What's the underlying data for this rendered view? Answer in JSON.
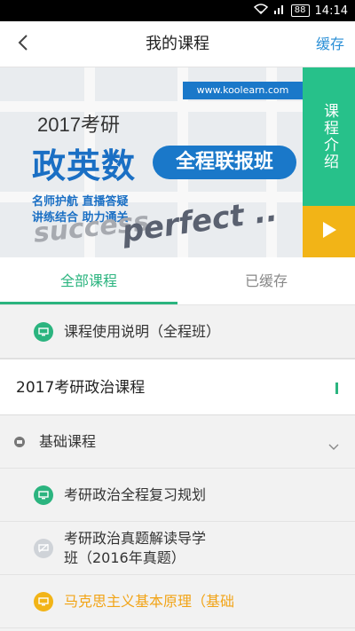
{
  "status_bar": {
    "signal_text": "88",
    "time": "14:14",
    "icons": [
      "wifi-icon",
      "signal-icon",
      "battery-icon"
    ]
  },
  "nav": {
    "back_icon": "chevron-left-icon",
    "title": "我的课程",
    "action_label": "缓存"
  },
  "banner": {
    "url_text": "www.koolearn.com",
    "year_text": "2017考研",
    "main_text": "政英数",
    "pill_text": "全程联报班",
    "sub_line1": "名师护航 直播答疑",
    "sub_line2": "讲练结合 助力通关",
    "watermark1": "success",
    "watermark2": "perfect ..",
    "intro_label": "课程介绍",
    "play_icon": "play-icon"
  },
  "tabs": [
    {
      "label": "全部课程",
      "active": true
    },
    {
      "label": "已缓存",
      "active": false
    }
  ],
  "guide_row": {
    "label": "课程使用说明（全程班）",
    "icon": "monitor-icon"
  },
  "course_section": {
    "title": "2017考研政治课程"
  },
  "group": {
    "label": "基础课程",
    "icon": "dot-icon",
    "chevron": "chevron-down-icon"
  },
  "lessons": [
    {
      "label": "考研政治全程复习规划",
      "icon": "monitor-icon",
      "state": "available"
    },
    {
      "label_line1": "考研政治真题解读导学",
      "label_line2": "班（2016年真题）",
      "icon": "monitor-off-icon",
      "state": "disabled"
    },
    {
      "label": "马克思主义基本原理（基础",
      "icon": "monitor-icon",
      "state": "current"
    }
  ],
  "colors": {
    "green": "#2bb47f",
    "intro_green": "#27c18a",
    "orange": "#f2b417",
    "blue": "#1a78c9",
    "link_blue": "#2a8fd6"
  }
}
